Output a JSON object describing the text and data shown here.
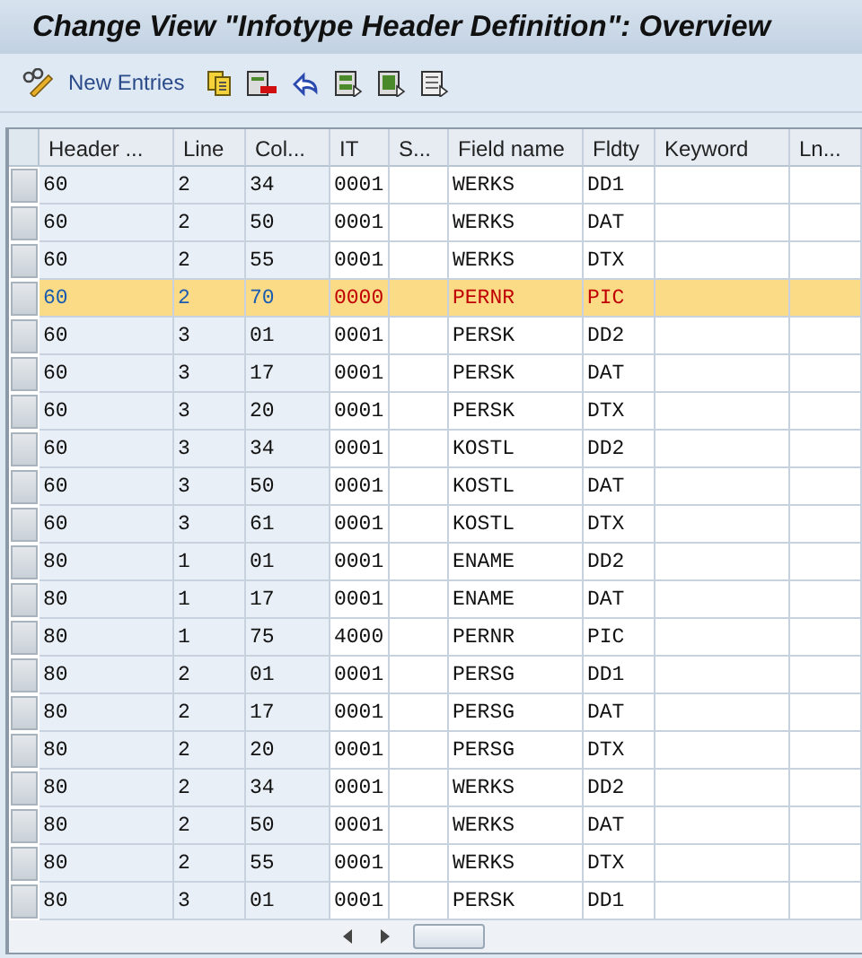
{
  "window": {
    "title": "Change View \"Infotype Header Definition\": Overview"
  },
  "toolbar": {
    "new_entries": "New Entries"
  },
  "table": {
    "columns": [
      "Header ...",
      "Line",
      "Col...",
      "IT",
      "S...",
      "Field name",
      "Fldty",
      "Keyword",
      "Ln..."
    ],
    "rows": [
      {
        "cells": [
          "60",
          "2",
          "34",
          "0001",
          "",
          "WERKS",
          "DD1",
          "",
          ""
        ],
        "selected": false
      },
      {
        "cells": [
          "60",
          "2",
          "50",
          "0001",
          "",
          "WERKS",
          "DAT",
          "",
          ""
        ],
        "selected": false
      },
      {
        "cells": [
          "60",
          "2",
          "55",
          "0001",
          "",
          "WERKS",
          "DTX",
          "",
          ""
        ],
        "selected": false
      },
      {
        "cells": [
          "60",
          "2",
          "70",
          "0000",
          "",
          "PERNR",
          "PIC",
          "",
          ""
        ],
        "selected": true
      },
      {
        "cells": [
          "60",
          "3",
          "01",
          "0001",
          "",
          "PERSK",
          "DD2",
          "",
          ""
        ],
        "selected": false
      },
      {
        "cells": [
          "60",
          "3",
          "17",
          "0001",
          "",
          "PERSK",
          "DAT",
          "",
          ""
        ],
        "selected": false
      },
      {
        "cells": [
          "60",
          "3",
          "20",
          "0001",
          "",
          "PERSK",
          "DTX",
          "",
          ""
        ],
        "selected": false
      },
      {
        "cells": [
          "60",
          "3",
          "34",
          "0001",
          "",
          "KOSTL",
          "DD2",
          "",
          ""
        ],
        "selected": false
      },
      {
        "cells": [
          "60",
          "3",
          "50",
          "0001",
          "",
          "KOSTL",
          "DAT",
          "",
          ""
        ],
        "selected": false
      },
      {
        "cells": [
          "60",
          "3",
          "61",
          "0001",
          "",
          "KOSTL",
          "DTX",
          "",
          ""
        ],
        "selected": false
      },
      {
        "cells": [
          "80",
          "1",
          "01",
          "0001",
          "",
          "ENAME",
          "DD2",
          "",
          ""
        ],
        "selected": false
      },
      {
        "cells": [
          "80",
          "1",
          "17",
          "0001",
          "",
          "ENAME",
          "DAT",
          "",
          ""
        ],
        "selected": false
      },
      {
        "cells": [
          "80",
          "1",
          "75",
          "4000",
          "",
          "PERNR",
          "PIC",
          "",
          ""
        ],
        "selected": false
      },
      {
        "cells": [
          "80",
          "2",
          "01",
          "0001",
          "",
          "PERSG",
          "DD1",
          "",
          ""
        ],
        "selected": false
      },
      {
        "cells": [
          "80",
          "2",
          "17",
          "0001",
          "",
          "PERSG",
          "DAT",
          "",
          ""
        ],
        "selected": false
      },
      {
        "cells": [
          "80",
          "2",
          "20",
          "0001",
          "",
          "PERSG",
          "DTX",
          "",
          ""
        ],
        "selected": false
      },
      {
        "cells": [
          "80",
          "2",
          "34",
          "0001",
          "",
          "WERKS",
          "DD2",
          "",
          ""
        ],
        "selected": false
      },
      {
        "cells": [
          "80",
          "2",
          "50",
          "0001",
          "",
          "WERKS",
          "DAT",
          "",
          ""
        ],
        "selected": false
      },
      {
        "cells": [
          "80",
          "2",
          "55",
          "0001",
          "",
          "WERKS",
          "DTX",
          "",
          ""
        ],
        "selected": false
      },
      {
        "cells": [
          "80",
          "3",
          "01",
          "0001",
          "",
          "PERSK",
          "DD1",
          "",
          ""
        ],
        "selected": false
      }
    ]
  }
}
